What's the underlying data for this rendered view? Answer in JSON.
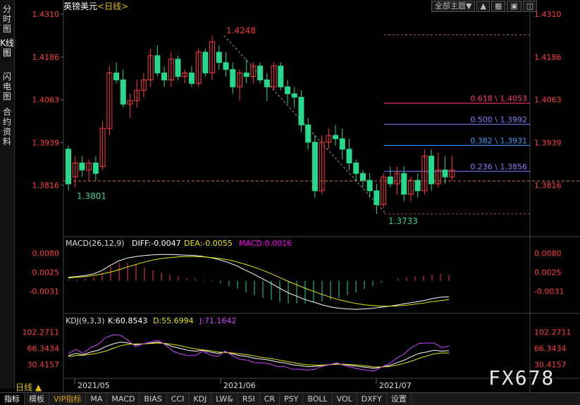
{
  "sidebar": {
    "tabs": [
      {
        "label": "分时图"
      },
      {
        "label": "K线图"
      },
      {
        "label": "闪电图"
      },
      {
        "label": "合约资料"
      }
    ]
  },
  "header": {
    "symbol": "英镑美元",
    "period": "<日线>",
    "theme_button": "全部主题▼"
  },
  "colors": {
    "up": "#ff3b3b",
    "down": "#27d98c",
    "axis_text": "#ff4040",
    "grid": "#1a1a1a",
    "dashed": "#b35050",
    "macd_diff": "#ffffff",
    "macd_dea": "#e6e600",
    "macd_bar": "#ff00ff",
    "k_line": "#ffffff",
    "d_line": "#e6e600",
    "j_line": "#d040ff"
  },
  "price_axis": [
    "1.4310",
    "1.4186",
    "1.4063",
    "1.3939",
    "1.3816"
  ],
  "macd_axis": [
    "0.0080",
    "0.0025",
    "-0.0031"
  ],
  "kdj_axis": [
    "102.2711",
    "66.3434",
    "30.4157"
  ],
  "date_axis": [
    "2021/05",
    "2021/06",
    "2021/07"
  ],
  "period_label": "日线 ▲",
  "bottom_tabs": [
    "指标",
    "模板",
    "VIP指标",
    "MA",
    "MACD",
    "BIAS",
    "CCI",
    "KDJ",
    "LW&",
    "RSI",
    "CR",
    "PSY",
    "BOLL",
    "VOL",
    "DXFY",
    "设置"
  ],
  "watermark": "FX678",
  "chart_data": {
    "type": "candlestick",
    "symbol": "英镑美元",
    "ylim": [
      1.375,
      1.431
    ],
    "highest": {
      "label": "1.4248",
      "value": 1.4248
    },
    "lowest": {
      "label": "1.3733",
      "value": 1.3733
    },
    "start_low": {
      "label": "1.3801",
      "value": 1.3801
    },
    "current_price": 1.3828,
    "fibonacci": [
      {
        "label": "0.618 \\ 1.4053",
        "value": 1.4053,
        "color": "#ff3b7a"
      },
      {
        "label": "0.500 \\ 1.3992",
        "value": 1.3992,
        "color": "#8080ff"
      },
      {
        "label": "0.382 \\ 1.3931",
        "value": 1.3931,
        "color": "#3aa0ff"
      },
      {
        "label": "0.236 \\ 1.3856",
        "value": 1.3856,
        "color": "#8080ff"
      }
    ],
    "top_dashed": 1.425,
    "candles": [
      [
        1.392,
        1.393,
        1.3801,
        1.382
      ],
      [
        1.384,
        1.39,
        1.381,
        1.388
      ],
      [
        1.388,
        1.39,
        1.384,
        1.386
      ],
      [
        1.386,
        1.389,
        1.383,
        1.388
      ],
      [
        1.388,
        1.39,
        1.383,
        1.385
      ],
      [
        1.387,
        1.4,
        1.386,
        1.398
      ],
      [
        1.398,
        1.416,
        1.396,
        1.414
      ],
      [
        1.414,
        1.417,
        1.411,
        1.412
      ],
      [
        1.412,
        1.415,
        1.404,
        1.405
      ],
      [
        1.405,
        1.408,
        1.401,
        1.406
      ],
      [
        1.406,
        1.412,
        1.404,
        1.409
      ],
      [
        1.409,
        1.414,
        1.407,
        1.412
      ],
      [
        1.412,
        1.421,
        1.41,
        1.419
      ],
      [
        1.419,
        1.422,
        1.413,
        1.414
      ],
      [
        1.414,
        1.416,
        1.41,
        1.412
      ],
      [
        1.412,
        1.42,
        1.41,
        1.418
      ],
      [
        1.418,
        1.419,
        1.412,
        1.413
      ],
      [
        1.413,
        1.415,
        1.411,
        1.414
      ],
      [
        1.414,
        1.416,
        1.41,
        1.411
      ],
      [
        1.411,
        1.421,
        1.41,
        1.42
      ],
      [
        1.42,
        1.421,
        1.413,
        1.414
      ],
      [
        1.414,
        1.4248,
        1.412,
        1.423
      ],
      [
        1.42,
        1.422,
        1.415,
        1.417
      ],
      [
        1.417,
        1.42,
        1.413,
        1.415
      ],
      [
        1.415,
        1.417,
        1.408,
        1.41
      ],
      [
        1.41,
        1.415,
        1.406,
        1.414
      ],
      [
        1.414,
        1.418,
        1.411,
        1.413
      ],
      [
        1.413,
        1.417,
        1.411,
        1.416
      ],
      [
        1.416,
        1.417,
        1.411,
        1.412
      ],
      [
        1.412,
        1.414,
        1.406,
        1.41
      ],
      [
        1.41,
        1.417,
        1.409,
        1.416
      ],
      [
        1.416,
        1.417,
        1.409,
        1.41
      ],
      [
        1.41,
        1.412,
        1.405,
        1.408
      ],
      [
        1.408,
        1.41,
        1.404,
        1.407
      ],
      [
        1.407,
        1.409,
        1.397,
        1.399
      ],
      [
        1.399,
        1.401,
        1.392,
        1.394
      ],
      [
        1.394,
        1.396,
        1.378,
        1.38
      ],
      [
        1.38,
        1.396,
        1.379,
        1.394
      ],
      [
        1.394,
        1.398,
        1.392,
        1.396
      ],
      [
        1.396,
        1.399,
        1.393,
        1.395
      ],
      [
        1.395,
        1.398,
        1.389,
        1.392
      ],
      [
        1.392,
        1.395,
        1.386,
        1.388
      ],
      [
        1.388,
        1.389,
        1.383,
        1.385
      ],
      [
        1.385,
        1.386,
        1.381,
        1.383
      ],
      [
        1.383,
        1.385,
        1.378,
        1.38
      ],
      [
        1.38,
        1.382,
        1.3733,
        1.376
      ],
      [
        1.376,
        1.385,
        1.375,
        1.384
      ],
      [
        1.384,
        1.387,
        1.381,
        1.382
      ],
      [
        1.382,
        1.387,
        1.379,
        1.385
      ],
      [
        1.385,
        1.387,
        1.377,
        1.379
      ],
      [
        1.379,
        1.384,
        1.377,
        1.383
      ],
      [
        1.383,
        1.385,
        1.378,
        1.38
      ],
      [
        1.38,
        1.392,
        1.379,
        1.39
      ],
      [
        1.39,
        1.392,
        1.38,
        1.382
      ],
      [
        1.382,
        1.391,
        1.381,
        1.386
      ],
      [
        1.386,
        1.39,
        1.382,
        1.384
      ],
      [
        1.384,
        1.39,
        1.383,
        1.386
      ]
    ],
    "macd": {
      "label": "MACD(26,12,9)",
      "diff_label": "DIFF:-0.0047",
      "dea_label": "DEA:-0.0055",
      "macd_label": "MACD:0.0016",
      "ylim": [
        -0.0095,
        0.0095
      ],
      "diff": [
        0.001,
        0.0012,
        0.0015,
        0.002,
        0.003,
        0.0045,
        0.0058,
        0.0066,
        0.007,
        0.0073,
        0.0075,
        0.0076,
        0.0076,
        0.0075,
        0.0074,
        0.0073,
        0.007,
        0.0066,
        0.006,
        0.0052,
        0.0042,
        0.003,
        0.0018,
        0.0005,
        -0.0008,
        -0.0022,
        -0.0035,
        -0.0045,
        -0.0055,
        -0.0062,
        -0.007,
        -0.0076,
        -0.008,
        -0.0082,
        -0.0083,
        -0.0082,
        -0.008,
        -0.0077,
        -0.0074,
        -0.007,
        -0.0066,
        -0.0062,
        -0.0058,
        -0.0052,
        -0.0048,
        -0.0047
      ],
      "dea": [
        0.0008,
        0.001,
        0.0012,
        0.0015,
        0.002,
        0.0025,
        0.0032,
        0.004,
        0.0047,
        0.0054,
        0.006,
        0.0064,
        0.0067,
        0.0069,
        0.007,
        0.007,
        0.0069,
        0.0067,
        0.0064,
        0.006,
        0.0054,
        0.0047,
        0.0039,
        0.003,
        0.002,
        0.0009,
        -0.0002,
        -0.0012,
        -0.0022,
        -0.0031,
        -0.004,
        -0.0048,
        -0.0055,
        -0.0061,
        -0.0066,
        -0.007,
        -0.0072,
        -0.0074,
        -0.0074,
        -0.0073,
        -0.0071,
        -0.0068,
        -0.0065,
        -0.0061,
        -0.0058,
        -0.0055
      ]
    },
    "kdj": {
      "label": "KDJ(9,3,3)",
      "k_label": "K:60.8543",
      "d_label": "D:55.6994",
      "j_label": "J:71.1642",
      "ylim": [
        0,
        120
      ],
      "k": [
        50,
        55,
        52,
        58,
        62,
        70,
        76,
        80,
        78,
        74,
        76,
        78,
        80,
        76,
        70,
        66,
        62,
        60,
        62,
        58,
        55,
        58,
        54,
        50,
        48,
        44,
        42,
        40,
        36,
        34,
        30,
        28,
        26,
        26,
        28,
        30,
        32,
        30,
        28,
        26,
        24,
        22,
        25,
        28,
        34,
        40,
        48,
        55,
        58,
        62,
        60,
        61
      ],
      "d": [
        48,
        50,
        51,
        53,
        56,
        60,
        66,
        72,
        75,
        76,
        76,
        77,
        78,
        77,
        75,
        72,
        68,
        65,
        63,
        61,
        58,
        57,
        56,
        54,
        52,
        49,
        46,
        44,
        41,
        38,
        35,
        32,
        30,
        29,
        29,
        30,
        31,
        31,
        30,
        29,
        27,
        25,
        25,
        26,
        29,
        33,
        38,
        44,
        49,
        54,
        56,
        56
      ],
      "j": [
        54,
        64,
        55,
        68,
        75,
        90,
        96,
        95,
        84,
        70,
        76,
        80,
        84,
        74,
        60,
        54,
        50,
        50,
        60,
        52,
        48,
        60,
        50,
        42,
        40,
        34,
        34,
        32,
        26,
        26,
        20,
        20,
        18,
        20,
        26,
        30,
        34,
        28,
        24,
        20,
        18,
        16,
        25,
        32,
        44,
        54,
        68,
        77,
        78,
        78,
        68,
        71
      ]
    }
  }
}
